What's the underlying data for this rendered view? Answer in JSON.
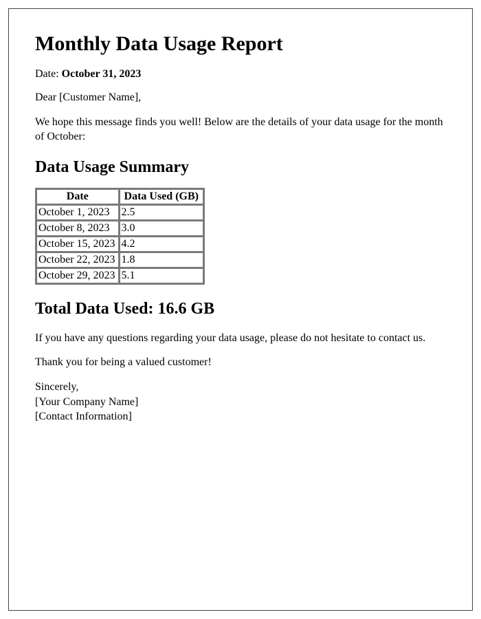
{
  "title": "Monthly Data Usage Report",
  "date_label": "Date: ",
  "date_value": "October 31, 2023",
  "greeting": "Dear [Customer Name],",
  "intro": "We hope this message finds you well! Below are the details of your data usage for the month of October:",
  "summary_heading": "Data Usage Summary",
  "table": {
    "headers": [
      "Date",
      "Data Used (GB)"
    ],
    "rows": [
      [
        "October 1, 2023",
        "2.5"
      ],
      [
        "October 8, 2023",
        "3.0"
      ],
      [
        "October 15, 2023",
        "4.2"
      ],
      [
        "October 22, 2023",
        "1.8"
      ],
      [
        "October 29, 2023",
        "5.1"
      ]
    ]
  },
  "total_heading": "Total Data Used: 16.6 GB",
  "closing1": "If you have any questions regarding your data usage, please do not hesitate to contact us.",
  "closing2": "Thank you for being a valued customer!",
  "signoff": {
    "line1": "Sincerely,",
    "line2": "[Your Company Name]",
    "line3": "[Contact Information]"
  },
  "chart_data": {
    "type": "table",
    "title": "Data Usage Summary",
    "columns": [
      "Date",
      "Data Used (GB)"
    ],
    "rows": [
      {
        "Date": "October 1, 2023",
        "Data Used (GB)": 2.5
      },
      {
        "Date": "October 8, 2023",
        "Data Used (GB)": 3.0
      },
      {
        "Date": "October 15, 2023",
        "Data Used (GB)": 4.2
      },
      {
        "Date": "October 22, 2023",
        "Data Used (GB)": 1.8
      },
      {
        "Date": "October 29, 2023",
        "Data Used (GB)": 5.1
      }
    ],
    "total_gb": 16.6
  }
}
